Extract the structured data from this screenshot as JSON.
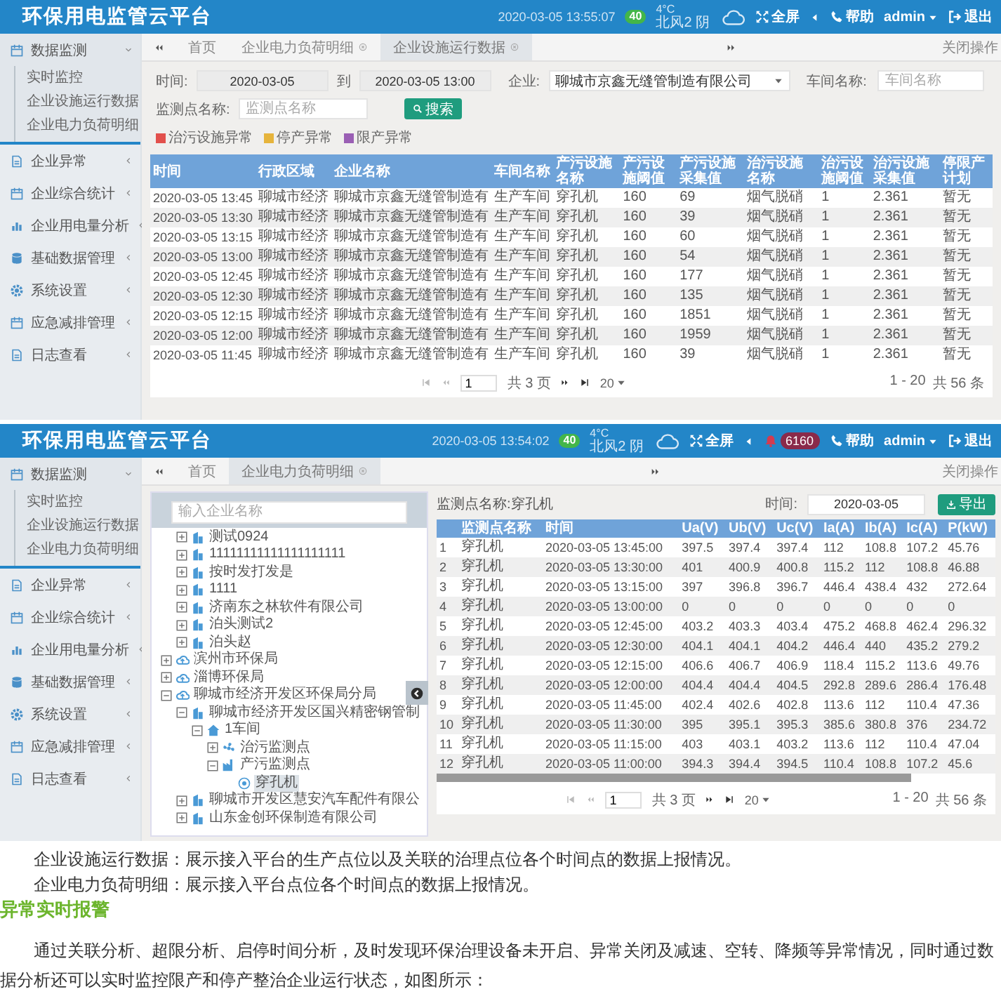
{
  "screens": [
    {
      "kind": "facility_data",
      "header": {
        "title": "环保用电监管云平台",
        "datetime": "2020-03-05  13:55:07",
        "aqi": "40",
        "temperature": "4°C",
        "weather": "北风2  阴",
        "fullscreen": "全屏",
        "help": "帮助",
        "user": "admin",
        "logout": "退出"
      },
      "sidebar": {
        "items": [
          {
            "label": "数据监测",
            "expanded": true,
            "children": [
              "实时监控",
              "企业设施运行数据",
              "企业电力负荷明细"
            ]
          },
          {
            "label": "企业异常",
            "expanded": false
          },
          {
            "label": "企业综合统计",
            "expanded": false
          },
          {
            "label": "企业用电量分析",
            "expanded": false
          },
          {
            "label": "基础数据管理",
            "expanded": false
          },
          {
            "label": "系统设置",
            "expanded": false
          },
          {
            "label": "应急减排管理",
            "expanded": false
          },
          {
            "label": "日志查看",
            "expanded": false
          }
        ]
      },
      "tabs": {
        "items": [
          {
            "label": "首页",
            "closable": false,
            "selected": false
          },
          {
            "label": "企业电力负荷明细",
            "closable": true,
            "selected": false
          },
          {
            "label": "企业设施运行数据",
            "closable": true,
            "selected": true
          }
        ],
        "close_all": "关闭操作"
      },
      "filters": {
        "time_label": "时间:",
        "date_from": "2020-03-05",
        "to_label": "到",
        "date_to": "2020-03-05 13:00",
        "enterprise_label": "企业:",
        "enterprise": "聊城市京鑫无缝管制造有限公司",
        "workshop_label": "车间名称:",
        "workshop_placeholder": "车间名称",
        "point_label": "监测点名称:",
        "point_placeholder": "监测点名称",
        "search_button": "搜索"
      },
      "legend": [
        {
          "label": "治污设施异常",
          "color": "#e2504c"
        },
        {
          "label": "停产异常",
          "color": "#e6b43c"
        },
        {
          "label": "限产异常",
          "color": "#9a5fb4"
        }
      ],
      "table": {
        "columns": [
          "时间",
          "行政区域",
          "企业名称",
          "车间名称",
          "产污设施名称",
          "产污设施阈值",
          "产污设施采集值",
          "治污设施名称",
          "治污设施阈值",
          "治污设施采集值",
          "停限产计划"
        ],
        "rows": [
          [
            "2020-03-05 13:45",
            "聊城市经济",
            "聊城市京鑫无缝管制造有",
            "生产车间",
            "穿孔机",
            "160",
            "69",
            "烟气脱硝",
            "1",
            "2.361",
            "暂无"
          ],
          [
            "2020-03-05 13:30",
            "聊城市经济",
            "聊城市京鑫无缝管制造有",
            "生产车间",
            "穿孔机",
            "160",
            "39",
            "烟气脱硝",
            "1",
            "2.361",
            "暂无"
          ],
          [
            "2020-03-05 13:15",
            "聊城市经济",
            "聊城市京鑫无缝管制造有",
            "生产车间",
            "穿孔机",
            "160",
            "60",
            "烟气脱硝",
            "1",
            "2.361",
            "暂无"
          ],
          [
            "2020-03-05 13:00",
            "聊城市经济",
            "聊城市京鑫无缝管制造有",
            "生产车间",
            "穿孔机",
            "160",
            "54",
            "烟气脱硝",
            "1",
            "2.361",
            "暂无"
          ],
          [
            "2020-03-05 12:45",
            "聊城市经济",
            "聊城市京鑫无缝管制造有",
            "生产车间",
            "穿孔机",
            "160",
            "177",
            "烟气脱硝",
            "1",
            "2.361",
            "暂无"
          ],
          [
            "2020-03-05 12:30",
            "聊城市经济",
            "聊城市京鑫无缝管制造有",
            "生产车间",
            "穿孔机",
            "160",
            "135",
            "烟气脱硝",
            "1",
            "2.361",
            "暂无"
          ],
          [
            "2020-03-05 12:15",
            "聊城市经济",
            "聊城市京鑫无缝管制造有",
            "生产车间",
            "穿孔机",
            "160",
            "1851",
            "烟气脱硝",
            "1",
            "2.361",
            "暂无"
          ],
          [
            "2020-03-05 12:00",
            "聊城市经济",
            "聊城市京鑫无缝管制造有",
            "生产车间",
            "穿孔机",
            "160",
            "1959",
            "烟气脱硝",
            "1",
            "2.361",
            "暂无"
          ],
          [
            "2020-03-05 11:45",
            "聊城市经济",
            "聊城市京鑫无缝管制造有",
            "生产车间",
            "穿孔机",
            "160",
            "39",
            "烟气脱硝",
            "1",
            "2.361",
            "暂无"
          ]
        ]
      },
      "pagination": {
        "page": "1",
        "total_pages": "共 3 页",
        "page_size": "20",
        "range": "1 - 20",
        "total": "共 56 条"
      }
    },
    {
      "kind": "power_load",
      "header": {
        "title": "环保用电监管云平台",
        "datetime": "2020-03-05  13:54:02",
        "aqi": "40",
        "temperature": "4°C",
        "weather": "北风2  阴",
        "fullscreen": "全屏",
        "notifications": "6160",
        "help": "帮助",
        "user": "admin",
        "logout": "退出"
      },
      "sidebar": {
        "items": [
          {
            "label": "数据监测",
            "expanded": true,
            "children": [
              "实时监控",
              "企业设施运行数据",
              "企业电力负荷明细"
            ]
          },
          {
            "label": "企业异常",
            "expanded": false
          },
          {
            "label": "企业综合统计",
            "expanded": false
          },
          {
            "label": "企业用电量分析",
            "expanded": false
          },
          {
            "label": "基础数据管理",
            "expanded": false
          },
          {
            "label": "系统设置",
            "expanded": false
          },
          {
            "label": "应急减排管理",
            "expanded": false
          },
          {
            "label": "日志查看",
            "expanded": false
          }
        ]
      },
      "tabs": {
        "items": [
          {
            "label": "首页",
            "closable": false,
            "selected": false
          },
          {
            "label": "企业电力负荷明细",
            "closable": true,
            "selected": true
          }
        ],
        "close_all": "关闭操作"
      },
      "tree": {
        "placeholder": "输入企业名称",
        "items": [
          {
            "children": [
              {
                "label": "测试0924",
                "kind": "enterprise",
                "expanded": false,
                "selected": false
              },
              {
                "label": "11111111111111111111",
                "kind": "enterprise",
                "expanded": false,
                "selected": false
              },
              {
                "label": "按时发打发是",
                "kind": "enterprise",
                "expanded": false,
                "selected": false
              },
              {
                "label": "1111",
                "kind": "enterprise",
                "expanded": false,
                "selected": false
              },
              {
                "label": "济南东之林软件有限公司",
                "kind": "enterprise",
                "expanded": false,
                "selected": false
              },
              {
                "label": "泊头测试2",
                "kind": "enterprise",
                "expanded": false,
                "selected": false
              },
              {
                "label": "泊头赵",
                "kind": "enterprise",
                "expanded": false,
                "selected": false
              }
            ]
          },
          {
            "label": "滨州市环保局",
            "kind": "bureau",
            "expanded": false,
            "selected": false
          },
          {
            "label": "淄博环保局",
            "kind": "bureau",
            "expanded": false,
            "selected": false
          },
          {
            "label": "聊城市经济开发区环保局分局",
            "kind": "bureau",
            "expanded": true,
            "selected": false,
            "children": [
              {
                "label": "聊城市经济开发区国兴精密钢管制",
                "kind": "enterprise",
                "expanded": true,
                "selected": false,
                "children": [
                  {
                    "label": "1车间",
                    "kind": "workshop",
                    "expanded": true,
                    "selected": false,
                    "children": [
                      {
                        "label": "治污监测点",
                        "kind": "treatment_point",
                        "expanded": false,
                        "selected": false
                      },
                      {
                        "label": "产污监测点",
                        "kind": "production_point",
                        "expanded": true,
                        "selected": false,
                        "children": [
                          {
                            "label": "穿孔机",
                            "kind": "device",
                            "selected": true
                          }
                        ]
                      }
                    ]
                  }
                ]
              },
              {
                "label": "聊城市开发区慧安汽车配件有限公",
                "kind": "enterprise",
                "expanded": false,
                "selected": false
              },
              {
                "label": "山东金创环保制造有限公司",
                "kind": "enterprise",
                "expanded": false,
                "selected": false
              }
            ]
          }
        ]
      },
      "toolbar": {
        "point_label": "监测点名称:穿孔机",
        "time_label": "时间:",
        "date": "2020-03-05",
        "export_button": "导出"
      },
      "table": {
        "columns": [
          "",
          "监测点名称",
          "时间",
          "Ua(V)",
          "Ub(V)",
          "Uc(V)",
          "Ia(A)",
          "Ib(A)",
          "Ic(A)",
          "P(kW)"
        ],
        "rows": [
          [
            "1",
            "穿孔机",
            "2020-03-05 13:45:00",
            "397.5",
            "397.4",
            "397.4",
            "112",
            "108.8",
            "107.2",
            "45.76"
          ],
          [
            "2",
            "穿孔机",
            "2020-03-05 13:30:00",
            "401",
            "400.9",
            "400.8",
            "115.2",
            "112",
            "108.8",
            "46.88"
          ],
          [
            "3",
            "穿孔机",
            "2020-03-05 13:15:00",
            "397",
            "396.8",
            "396.7",
            "446.4",
            "438.4",
            "432",
            "272.64"
          ],
          [
            "4",
            "穿孔机",
            "2020-03-05 13:00:00",
            "0",
            "0",
            "0",
            "0",
            "0",
            "0",
            "0"
          ],
          [
            "5",
            "穿孔机",
            "2020-03-05 12:45:00",
            "403.2",
            "403.3",
            "403.4",
            "475.2",
            "468.8",
            "462.4",
            "296.32"
          ],
          [
            "6",
            "穿孔机",
            "2020-03-05 12:30:00",
            "404.1",
            "404.1",
            "404.2",
            "446.4",
            "440",
            "435.2",
            "279.2"
          ],
          [
            "7",
            "穿孔机",
            "2020-03-05 12:15:00",
            "406.6",
            "406.7",
            "406.9",
            "118.4",
            "115.2",
            "113.6",
            "49.76"
          ],
          [
            "8",
            "穿孔机",
            "2020-03-05 12:00:00",
            "404.4",
            "404.4",
            "404.5",
            "292.8",
            "289.6",
            "286.4",
            "176.48"
          ],
          [
            "9",
            "穿孔机",
            "2020-03-05 11:45:00",
            "402.4",
            "402.6",
            "402.8",
            "113.6",
            "112",
            "110.4",
            "47.36"
          ],
          [
            "10",
            "穿孔机",
            "2020-03-05 11:30:00",
            "395",
            "395.1",
            "395.3",
            "385.6",
            "380.8",
            "376",
            "234.72"
          ],
          [
            "11",
            "穿孔机",
            "2020-03-05 11:15:00",
            "403",
            "403.1",
            "403.2",
            "113.6",
            "112",
            "110.4",
            "47.04"
          ],
          [
            "12",
            "穿孔机",
            "2020-03-05 11:00:00",
            "394.3",
            "394.4",
            "394.5",
            "110.4",
            "108.8",
            "107.2",
            "45.6"
          ]
        ]
      },
      "pagination": {
        "page": "1",
        "total_pages": "共 3 页",
        "page_size": "20",
        "range": "1 - 20",
        "total": "共 56 条"
      }
    }
  ],
  "article": [
    {
      "kind": "paragraph",
      "text": "企业设施运行数据：展示接入平台的生产点位以及关联的治理点位各个时间点的数据上报情况。"
    },
    {
      "kind": "paragraph",
      "text": "企业电力负荷明细：展示接入平台点位各个时间点的数据上报情况。"
    },
    {
      "kind": "heading",
      "text": "异常实时报警"
    },
    {
      "kind": "paragraph",
      "text": "通过关联分析、超限分析、启停时间分析，及时发现环保治理设备未开启、异常关闭及减速、空转、降频等异常情况，同时通过数据分析还可以实时监控限产和停产整治企业运行状态，如图所示："
    }
  ]
}
